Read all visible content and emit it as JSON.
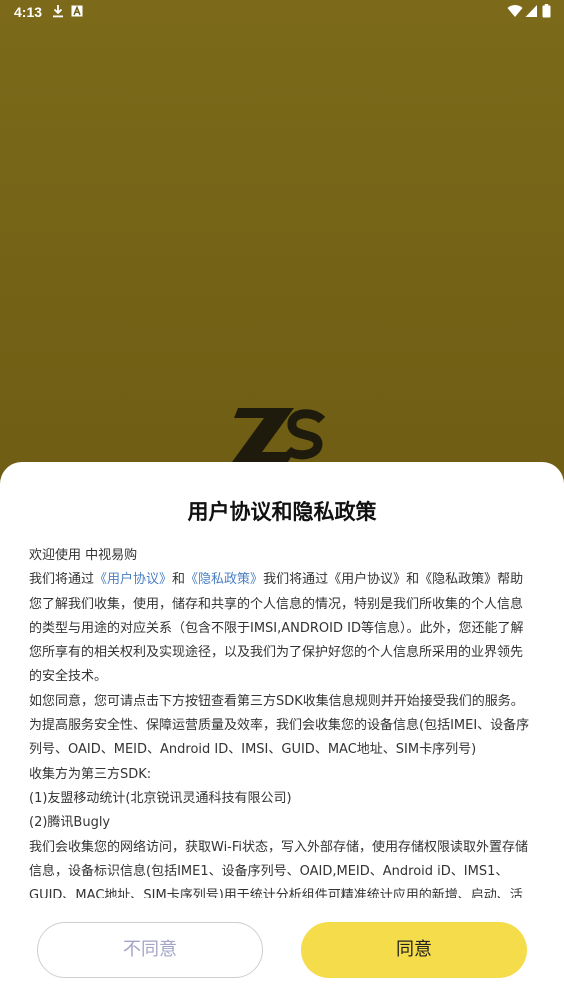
{
  "status_bar": {
    "time": "4:13",
    "icons": [
      "download-icon",
      "a-box-icon",
      "wifi-icon",
      "signal-icon",
      "battery-icon"
    ]
  },
  "background": {
    "logo_text": "ZS"
  },
  "dialog": {
    "title": "用户协议和隐私政策",
    "welcome": "欢迎使用   中视易购",
    "intro_prefix": "我们将通过",
    "link_user_agreement": "《用户协议》",
    "and": "和",
    "link_privacy_policy": "《隐私政策》",
    "intro_rest": "我们将通过《用户协议》和《隐私政策》帮助您了解我们收集，使用，储存和共享的个人信息的情况，特别是我们所收集的个人信息的类型与用途的对应关系（包含不限于IMSI,ANDROID ID等信息）。此外，您还能了解您所享有的相关权利及实现途径，以及我们为了保护好您的个人信息所采用的业界领先的安全技术。",
    "paragraphs": [
      "如您同意，您可请点击下方按钮查看第三方SDK收集信息规则并开始接受我们的服务。",
      "为提高服务安全性、保障运营质量及效率，我们会收集您的设备信息(包括IMEI、设备序列号、OAID、MEID、Android ID、IMSI、GUID、MAC地址、SIM卡序列号)",
      "收集方为第三方SDK:",
      "(1)友盟移动统计(北京锐讯灵通科技有限公司)",
      "(2)腾讯Bugly",
      "我们会收集您的网络访问，获取Wi-Fi状态，写入外部存储，使用存储权限读取外置存储信息，设备标识信息(包括IME1、设备序列号、OAID,MEID、Android iD、IMS1、GUID、MAC地址、SIM卡序列号)用于统计分析组件可精准统计应用的新增、启动、活"
    ],
    "buttons": {
      "disagree": "不同意",
      "agree": "同意"
    }
  },
  "colors": {
    "backdrop": "#6f5e14",
    "link": "#4a7fc1",
    "agree_button": "#f5dc4a",
    "disagree_text": "#a3a3c8"
  }
}
